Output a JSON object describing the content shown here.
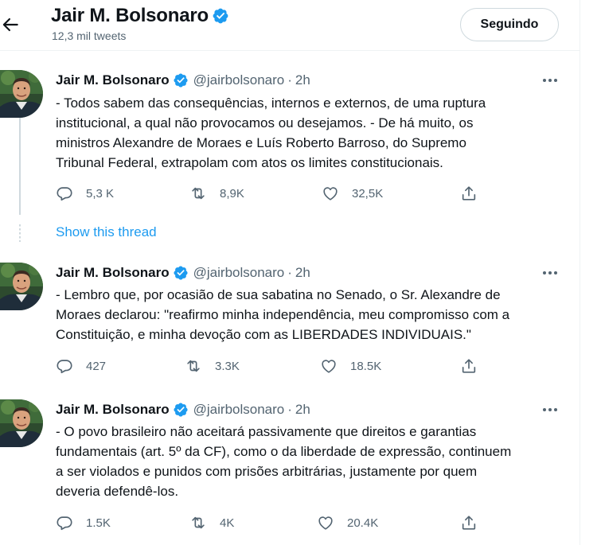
{
  "header": {
    "name": "Jair M. Bolsonaro",
    "tweet_count": "12,3 mil tweets",
    "follow_label": "Seguindo"
  },
  "colors": {
    "accent": "#1d9bf0",
    "text": "#0f1419",
    "muted": "#536471"
  },
  "show_thread": "Show this thread",
  "tweets": [
    {
      "name": "Jair M. Bolsonaro",
      "handle": "@jairbolsonaro",
      "dot": "·",
      "time": "2h",
      "lines": [
        "- Todos sabem das consequências, internos e externos, de uma ruptura",
        "institucional, a qual não provocamos ou desejamos. - De há muito, os",
        "ministros Alexandre de Moraes e Luís Roberto Barroso, do Supremo",
        "Tribunal Federal, extrapolam com atos os limites constitucionais."
      ],
      "replies": "5,3 K",
      "retweets": "8,9K",
      "likes": "32,5K"
    },
    {
      "name": "Jair M. Bolsonaro",
      "handle": "@jairbolsonaro",
      "dot": "·",
      "time": "2h",
      "lines": [
        "- Lembro que, por ocasião de sua sabatina no Senado, o Sr. Alexandre de",
        "Moraes declarou: \"reafirmo minha independência, meu compromisso com a",
        "Constituição, e minha devoção com as LIBERDADES INDIVIDUAIS.\""
      ],
      "replies": "427",
      "retweets": "3.3K",
      "likes": "18.5K"
    },
    {
      "name": "Jair M. Bolsonaro",
      "handle": "@jairbolsonaro",
      "dot": "·",
      "time": "2h",
      "lines": [
        "- O povo brasileiro não aceitará passivamente que direitos e garantias",
        "fundamentais (art. 5º da CF), como o da liberdade de expressão, continuem",
        "a ser violados e punidos com prisões arbitrárias, justamente por quem",
        "deveria defendê-los."
      ],
      "replies": "1.5K",
      "retweets": "4K",
      "likes": "20.4K"
    }
  ]
}
